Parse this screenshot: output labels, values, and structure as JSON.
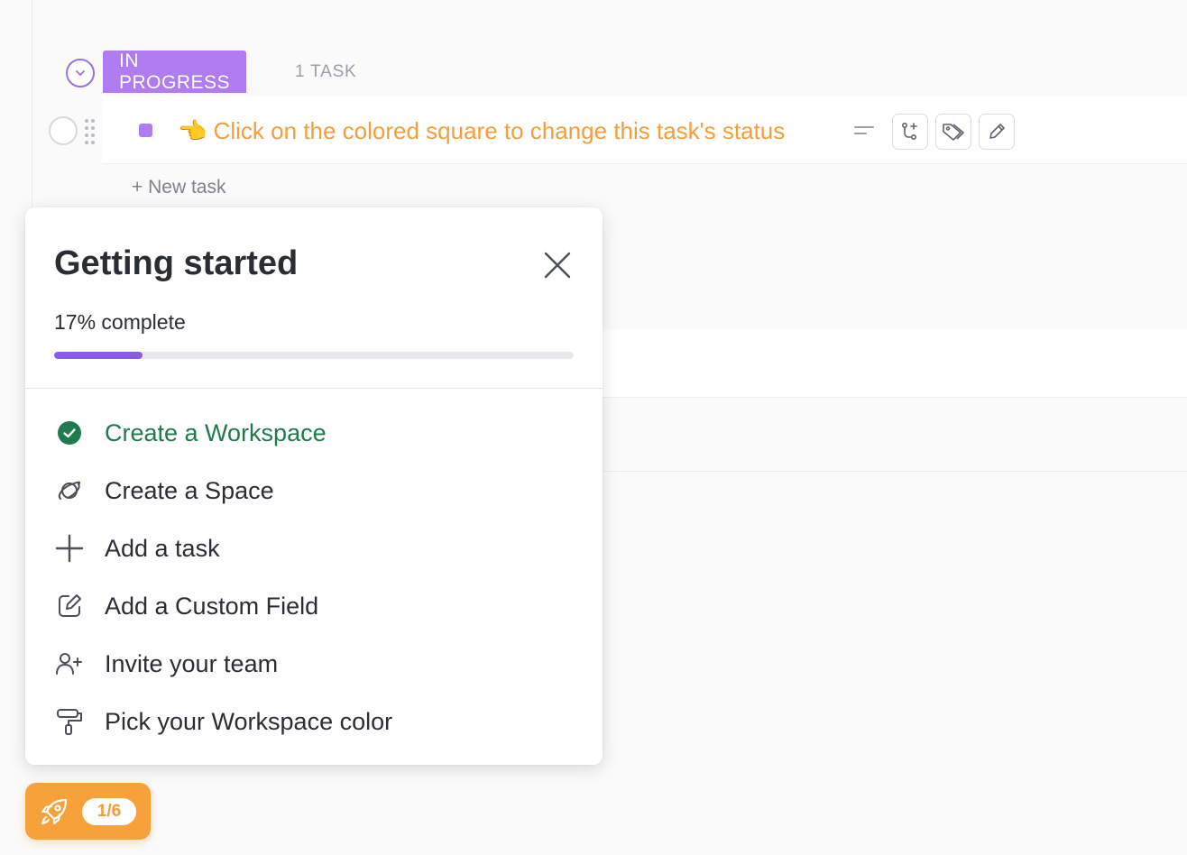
{
  "group": {
    "status_label": "IN PROGRESS",
    "count_label": "1 TASK",
    "status_color": "#b07cf2"
  },
  "task": {
    "name": "👈 Click on the colored square to change this task's status",
    "name_color": "#f59e3b",
    "actions": [
      "subtask-icon",
      "tag-icon",
      "pencil-icon"
    ]
  },
  "list": {
    "new_task_label": "+ New task"
  },
  "onboarding": {
    "title": "Getting started",
    "progress_label": "17% complete",
    "progress_fraction": 0.17,
    "steps": [
      {
        "label": "Create a Workspace",
        "icon": "check-circle-icon",
        "done": true
      },
      {
        "label": "Create a Space",
        "icon": "planet-icon",
        "done": false
      },
      {
        "label": "Add a task",
        "icon": "plus-icon",
        "done": false
      },
      {
        "label": "Add a Custom Field",
        "icon": "edit-field-icon",
        "done": false
      },
      {
        "label": "Invite your team",
        "icon": "add-user-icon",
        "done": false
      },
      {
        "label": "Pick your Workspace color",
        "icon": "paint-roller-icon",
        "done": false
      }
    ],
    "accent_color": "#8a5ce6",
    "done_color": "#1f7a4d"
  },
  "launcher": {
    "badge": "1/6",
    "icon": "rocket-icon",
    "color": "#f7a13a"
  }
}
